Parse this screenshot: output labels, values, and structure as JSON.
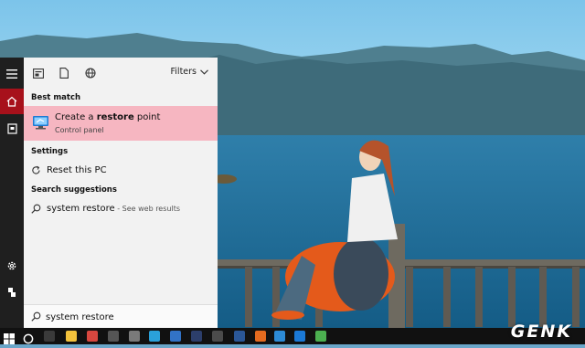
{
  "panel": {
    "filters_label": "Filters",
    "best_match_header": "Best match",
    "best_match": {
      "title_pre": "Create a ",
      "title_bold": "restore",
      "title_post": " point",
      "subtitle": "Control panel"
    },
    "settings_header": "Settings",
    "settings_item": "Reset this PC",
    "suggestions_header": "Search suggestions",
    "suggestion": {
      "text": "system restore",
      "sub": " - See web results"
    },
    "search_value": "system restore"
  },
  "watermark": "GENK",
  "colors": {
    "rail_bg": "#1f1f1f",
    "rail_active": "#a7111b",
    "panel_bg": "#f2f2f2",
    "highlight": "#f6b6c1",
    "taskbar": "#111111",
    "accent_blue": "#1d7bd3"
  },
  "icons": {
    "rail": [
      "hamburger-icon",
      "home-icon",
      "documents-icon",
      "gear-icon",
      "user-icon"
    ],
    "toolbar": [
      "apps-icon",
      "document-icon",
      "globe-icon"
    ],
    "row": [
      "restore-point-icon",
      "reset-icon",
      "search-icon"
    ]
  }
}
